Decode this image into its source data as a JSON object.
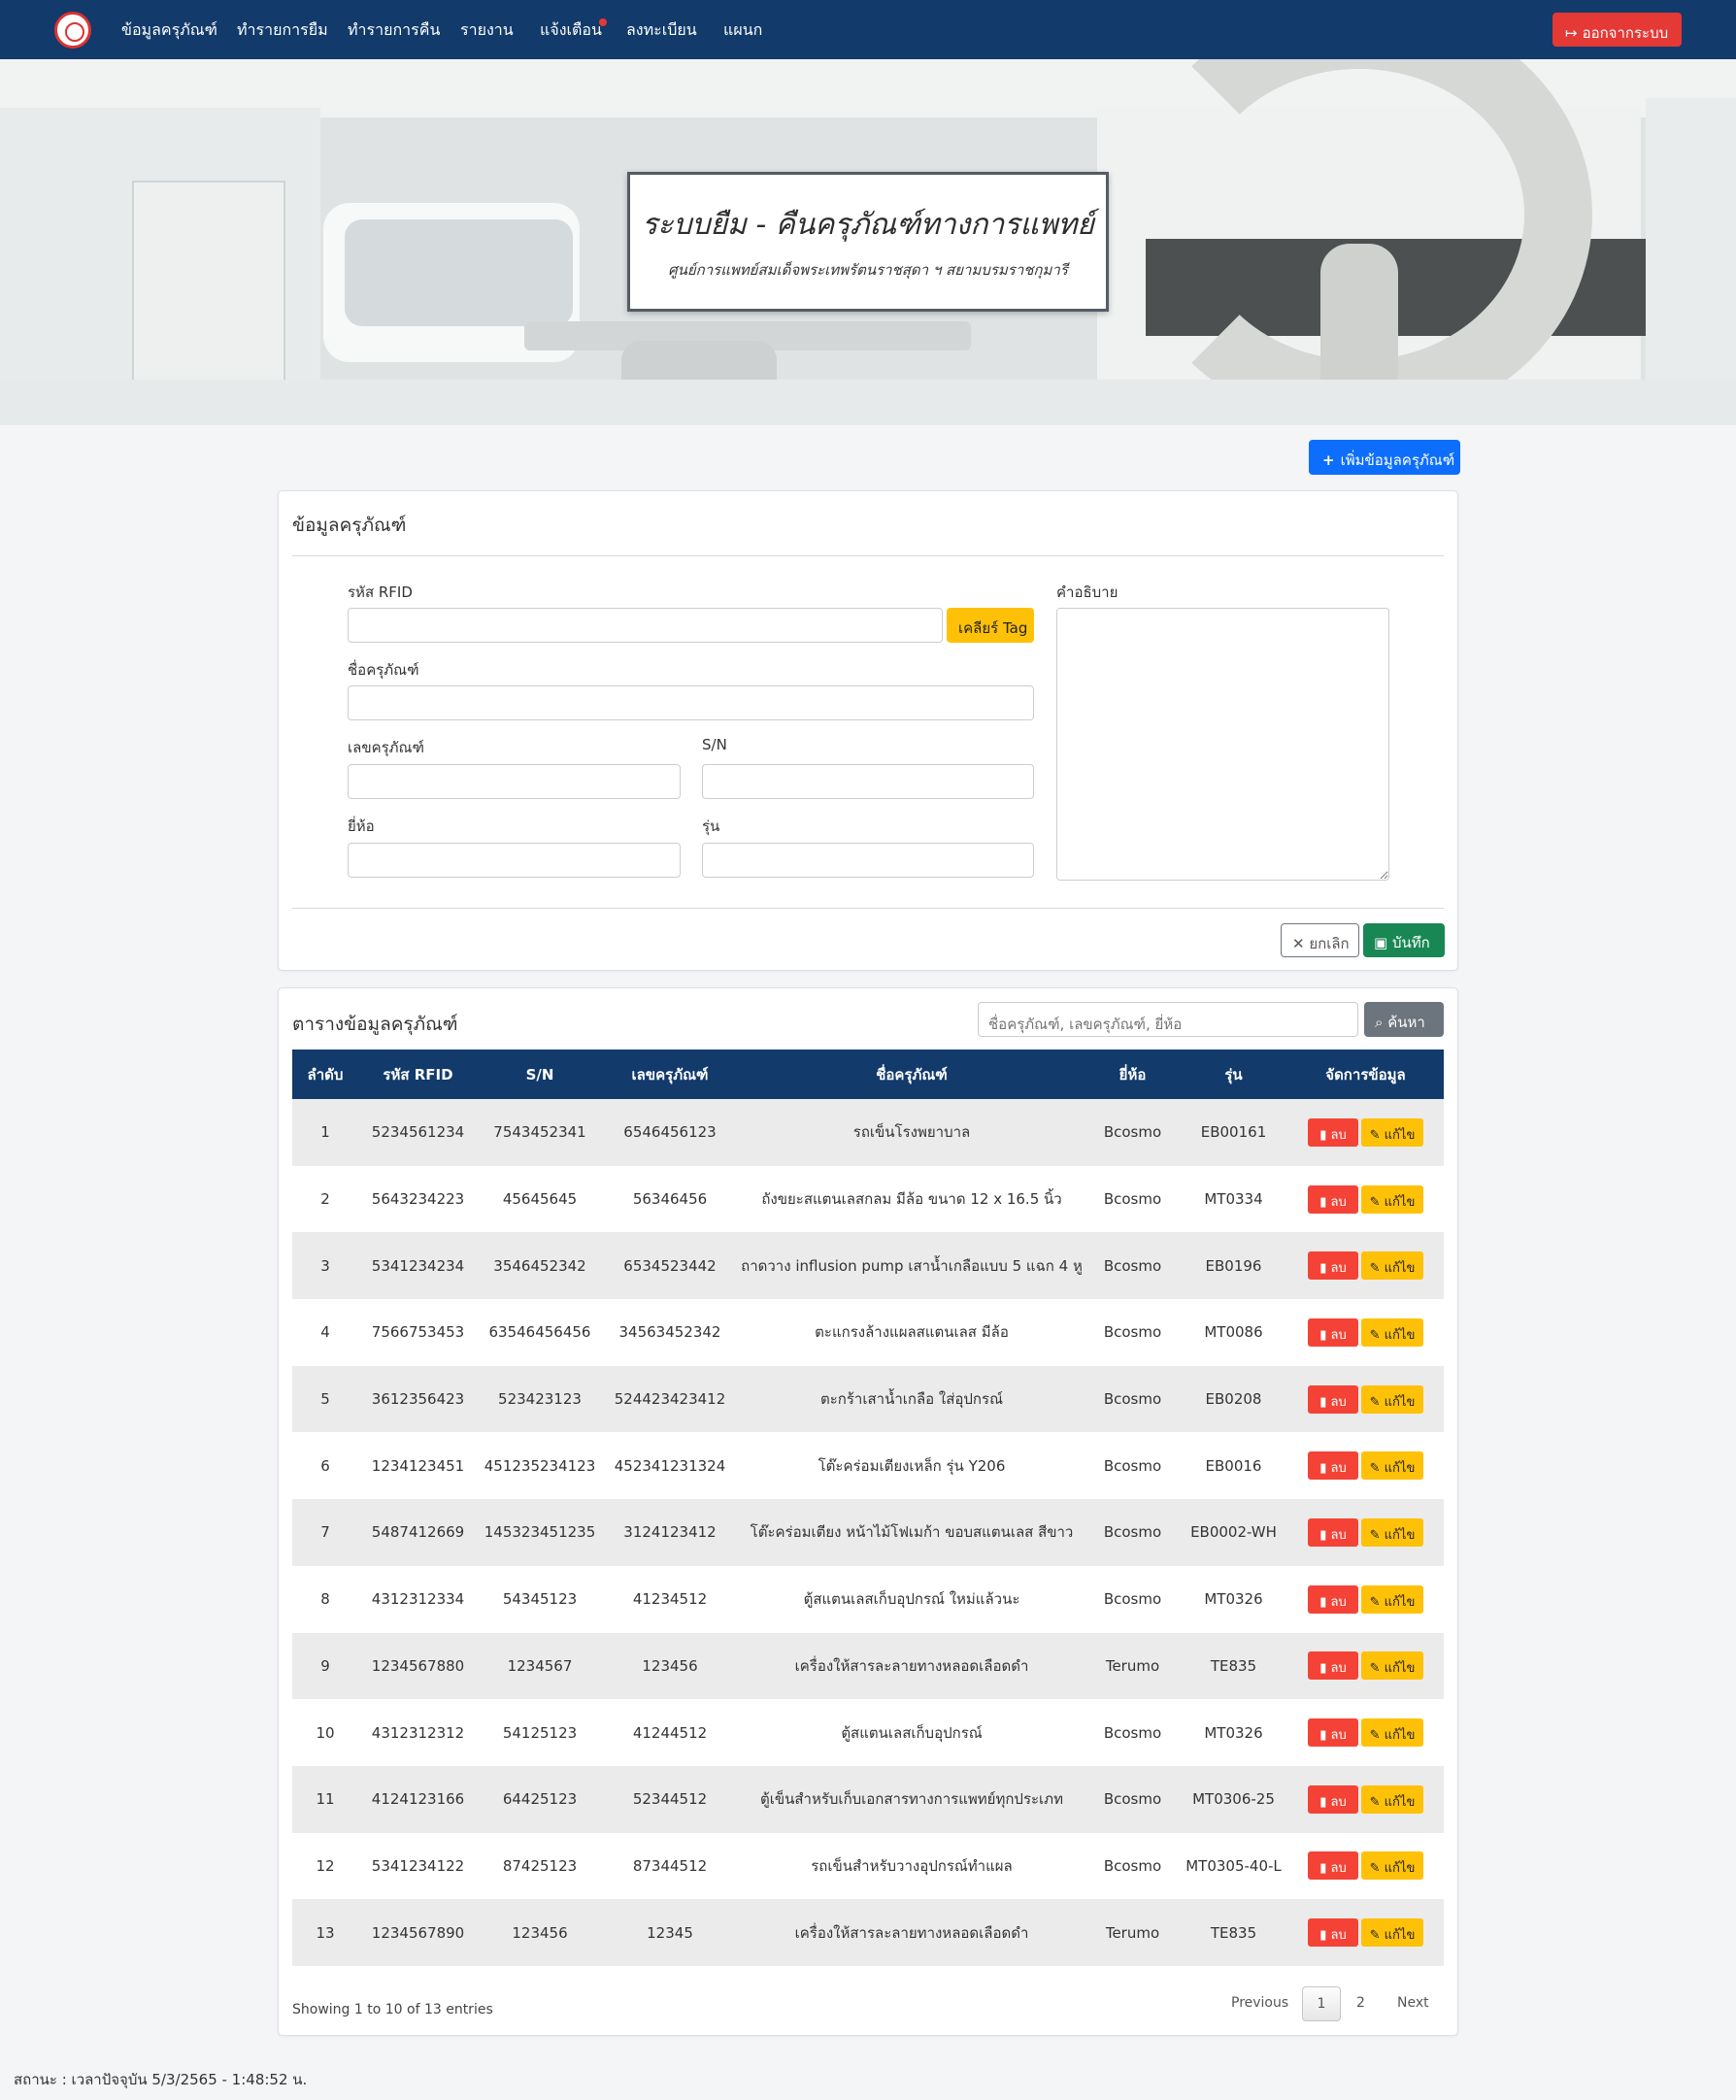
{
  "nav": {
    "items": [
      "ข้อมูลครุภัณฑ์",
      "ทำรายการยืม",
      "ทำรายการคืน",
      "รายงาน",
      "แจ้งเตือน",
      "ลงทะเบียน",
      "แผนก"
    ],
    "logout_label": "ออกจากระบบ"
  },
  "hero": {
    "title": "ระบบยืม - คืนครุภัณฑ์ทางการแพทย์",
    "subtitle": "ศูนย์การแพทย์สมเด็จพระเทพรัตนราชสุดา ฯ สยามบรมราชกุมารี"
  },
  "add_button_label": "เพิ่มข้อมูลครุภัณฑ์",
  "form": {
    "title": "ข้อมูลครุภัณฑ์",
    "rfid_label": "รหัส RFID",
    "clear_tag_label": "เคลียร์ Tag",
    "description_label": "คำอธิบาย",
    "name_label": "ชื่อครุภัณฑ์",
    "asset_no_label": "เลขครุภัณฑ์",
    "sn_label": "S/N",
    "brand_label": "ยี่ห้อ",
    "model_label": "รุ่น",
    "rfid_value": "",
    "name_value": "",
    "asset_no_value": "",
    "sn_value": "",
    "brand_value": "",
    "model_value": "",
    "description_value": "",
    "cancel_label": "ยกเลิก",
    "save_label": "บันทึก"
  },
  "table": {
    "title": "ตารางข้อมูลครุภัณฑ์",
    "search_placeholder": "ชื่อครุภัณฑ์, เลขครุภัณฑ์, ยี่ห้อ",
    "search_label": "ค้นหา",
    "columns": [
      "ลำดับ",
      "รหัส RFID",
      "S/N",
      "เลขครุภัณฑ์",
      "ชื่อครุภัณฑ์",
      "ยี่ห้อ",
      "รุ่น",
      "จัดการข้อมูล"
    ],
    "delete_label": "ลบ",
    "edit_label": "แก้ไข",
    "rows": [
      {
        "no": "1",
        "rfid": "5234561234",
        "sn": "7543452341",
        "asset_no": "6546456123",
        "name": "รถเข็นโรงพยาบาล",
        "brand": "Bcosmo",
        "model": "EB00161"
      },
      {
        "no": "2",
        "rfid": "5643234223",
        "sn": "45645645",
        "asset_no": "56346456",
        "name": "ถังขยะสแตนเลสกลม มีล้อ ขนาด 12 x 16.5 นิ้ว",
        "brand": "Bcosmo",
        "model": "MT0334"
      },
      {
        "no": "3",
        "rfid": "5341234234",
        "sn": "3546452342",
        "asset_no": "6534523442",
        "name": "ถาดวาง influsion pump เสาน้ำเกลือแบบ 5 แฉก 4 หู",
        "brand": "Bcosmo",
        "model": "EB0196"
      },
      {
        "no": "4",
        "rfid": "7566753453",
        "sn": "63546456456",
        "asset_no": "34563452342",
        "name": "ตะแกรงล้างแผลสแตนเลส มีล้อ",
        "brand": "Bcosmo",
        "model": "MT0086"
      },
      {
        "no": "5",
        "rfid": "3612356423",
        "sn": "523423123",
        "asset_no": "524423423412",
        "name": "ตะกร้าเสาน้ำเกลือ ใส่อุปกรณ์",
        "brand": "Bcosmo",
        "model": "EB0208"
      },
      {
        "no": "6",
        "rfid": "1234123451",
        "sn": "451235234123",
        "asset_no": "452341231324",
        "name": "โต๊ะคร่อมเตียงเหล็ก รุ่น Y206",
        "brand": "Bcosmo",
        "model": "EB0016"
      },
      {
        "no": "7",
        "rfid": "5487412669",
        "sn": "145323451235",
        "asset_no": "3124123412",
        "name": "โต๊ะคร่อมเตียง หน้าไม้โฟเมก้า ขอบสแตนเลส สีขาว",
        "brand": "Bcosmo",
        "model": "EB0002-WH"
      },
      {
        "no": "8",
        "rfid": "4312312334",
        "sn": "54345123",
        "asset_no": "41234512",
        "name": "ตู้สแตนเลสเก็บอุปกรณ์ ใหม่แล้วนะ",
        "brand": "Bcosmo",
        "model": "MT0326"
      },
      {
        "no": "9",
        "rfid": "1234567880",
        "sn": "1234567",
        "asset_no": "123456",
        "name": "เครื่องให้สารละลายทางหลอดเลือดดำ",
        "brand": "Terumo",
        "model": "TE835"
      },
      {
        "no": "10",
        "rfid": "4312312312",
        "sn": "54125123",
        "asset_no": "41244512",
        "name": "ตู้สแตนเลสเก็บอุปกรณ์",
        "brand": "Bcosmo",
        "model": "MT0326"
      },
      {
        "no": "11",
        "rfid": "4124123166",
        "sn": "64425123",
        "asset_no": "52344512",
        "name": "ตู้เข็นสำหรับเก็บเอกสารทางการแพทย์ทุกประเภท",
        "brand": "Bcosmo",
        "model": "MT0306-25"
      },
      {
        "no": "12",
        "rfid": "5341234122",
        "sn": "87425123",
        "asset_no": "87344512",
        "name": "รถเข็นสำหรับวางอุปกรณ์ทำแผล",
        "brand": "Bcosmo",
        "model": "MT0305-40-L"
      },
      {
        "no": "13",
        "rfid": "1234567890",
        "sn": "123456",
        "asset_no": "12345",
        "name": "เครื่องให้สารละลายทางหลอดเลือดดำ",
        "brand": "Terumo",
        "model": "TE835"
      }
    ],
    "showing": "Showing 1 to 10 of 13 entries",
    "pagination": {
      "previous": "Previous",
      "pages": [
        "1",
        "2"
      ],
      "next": "Next",
      "current": "1"
    }
  },
  "status_text": "สถานะ : เวลาปัจจุบัน 5/3/2565 - 1:48:52 น.",
  "colors": {
    "navbar": "#123a6b",
    "danger": "#f44336",
    "warning": "#ffc107",
    "primary": "#0d6efd",
    "success": "#198754",
    "secondary": "#6c757d"
  }
}
